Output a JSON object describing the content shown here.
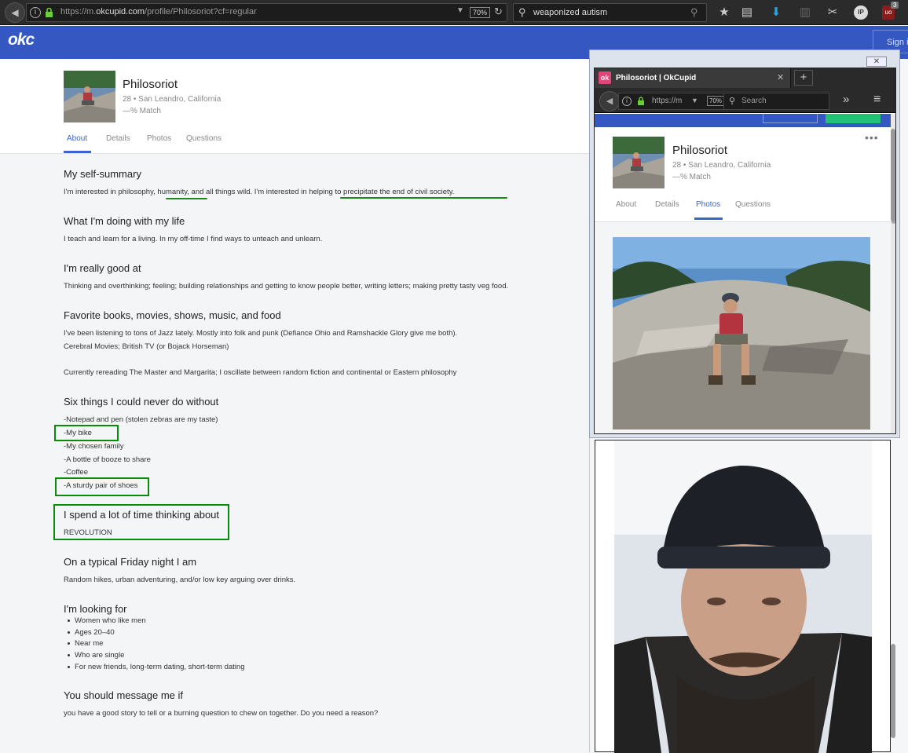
{
  "browser": {
    "url_prefix": "https://m.",
    "url_domain": "okcupid.com",
    "url_path": "/profile/Philosoriot?cf=regular",
    "zoom": "70%",
    "search_value": "weaponized autism",
    "ublock_count": "3",
    "ip_label": "IP"
  },
  "okc": {
    "logo": "okc",
    "signin": "Sign i"
  },
  "profile": {
    "name": "Philosoriot",
    "meta": "28 • San Leandro, California",
    "match": "—% Match",
    "tabs": [
      "About",
      "Details",
      "Photos",
      "Questions"
    ]
  },
  "essays": {
    "summary_title": "My self-summary",
    "summary_a": "I'm interested in philosophy,",
    "summary_b": "humanity,",
    "summary_c": "and all things wild. I'm interested in",
    "summary_d": "helping to precipitate the end of civil society.",
    "doing_title": "What I'm doing with my life",
    "doing_text": "I teach and learn for a living. In my off-time I find ways to unteach and unlearn.",
    "good_title": "I'm really good at",
    "good_text": "Thinking and overthinking; feeling; building relationships and getting to know people better, writing letters; making pretty tasty veg food.",
    "fav_title": "Favorite books, movies, shows, music, and food",
    "fav_line1": "I've been listening to tons of Jazz lately. Mostly into folk and punk (Defiance Ohio and Ramshackle Glory give me both).",
    "fav_line2": "Cerebral Movies; British TV (or Bojack Horseman)",
    "fav_line3": "Currently rereading The Master and Margarita; I oscillate between random fiction and continental or Eastern philosophy",
    "six_title": "Six things I could never do without",
    "six_items": [
      "-Notepad and pen (stolen zebras are my taste)",
      "-My bike",
      "-My chosen family",
      "-A bottle of booze to share",
      "-Coffee",
      "-A sturdy pair of shoes"
    ],
    "think_title": "I spend a lot of time thinking about",
    "think_text": "REVOLUTION",
    "friday_title": "On a typical Friday night I am",
    "friday_text": "Random hikes, urban adventuring, and/or low key arguing over drinks.",
    "looking_title": "I'm looking for",
    "looking_items": [
      "Women who like men",
      "Ages 20–40",
      "Near me",
      "Who are single",
      "For new friends, long-term dating, short-term dating"
    ],
    "message_title": "You should message me if",
    "message_text": "you have a good story to tell or a burning question to chew on together. Do you need a reason?"
  },
  "popup": {
    "tab_title": "Philosoriot | OkCupid",
    "favicon": "ok",
    "url_text": "https://m",
    "zoom": "70%",
    "search_placeholder": "Search",
    "name": "Philosoriot",
    "meta": "28 • San Leandro, California",
    "match": "—% Match",
    "tabs": [
      "About",
      "Details",
      "Photos",
      "Questions"
    ],
    "active_tab": "Photos"
  },
  "colors": {
    "okc_blue": "#3557c1",
    "tab_active": "#3a66c9",
    "annotation_green": "#0a8a0a"
  }
}
